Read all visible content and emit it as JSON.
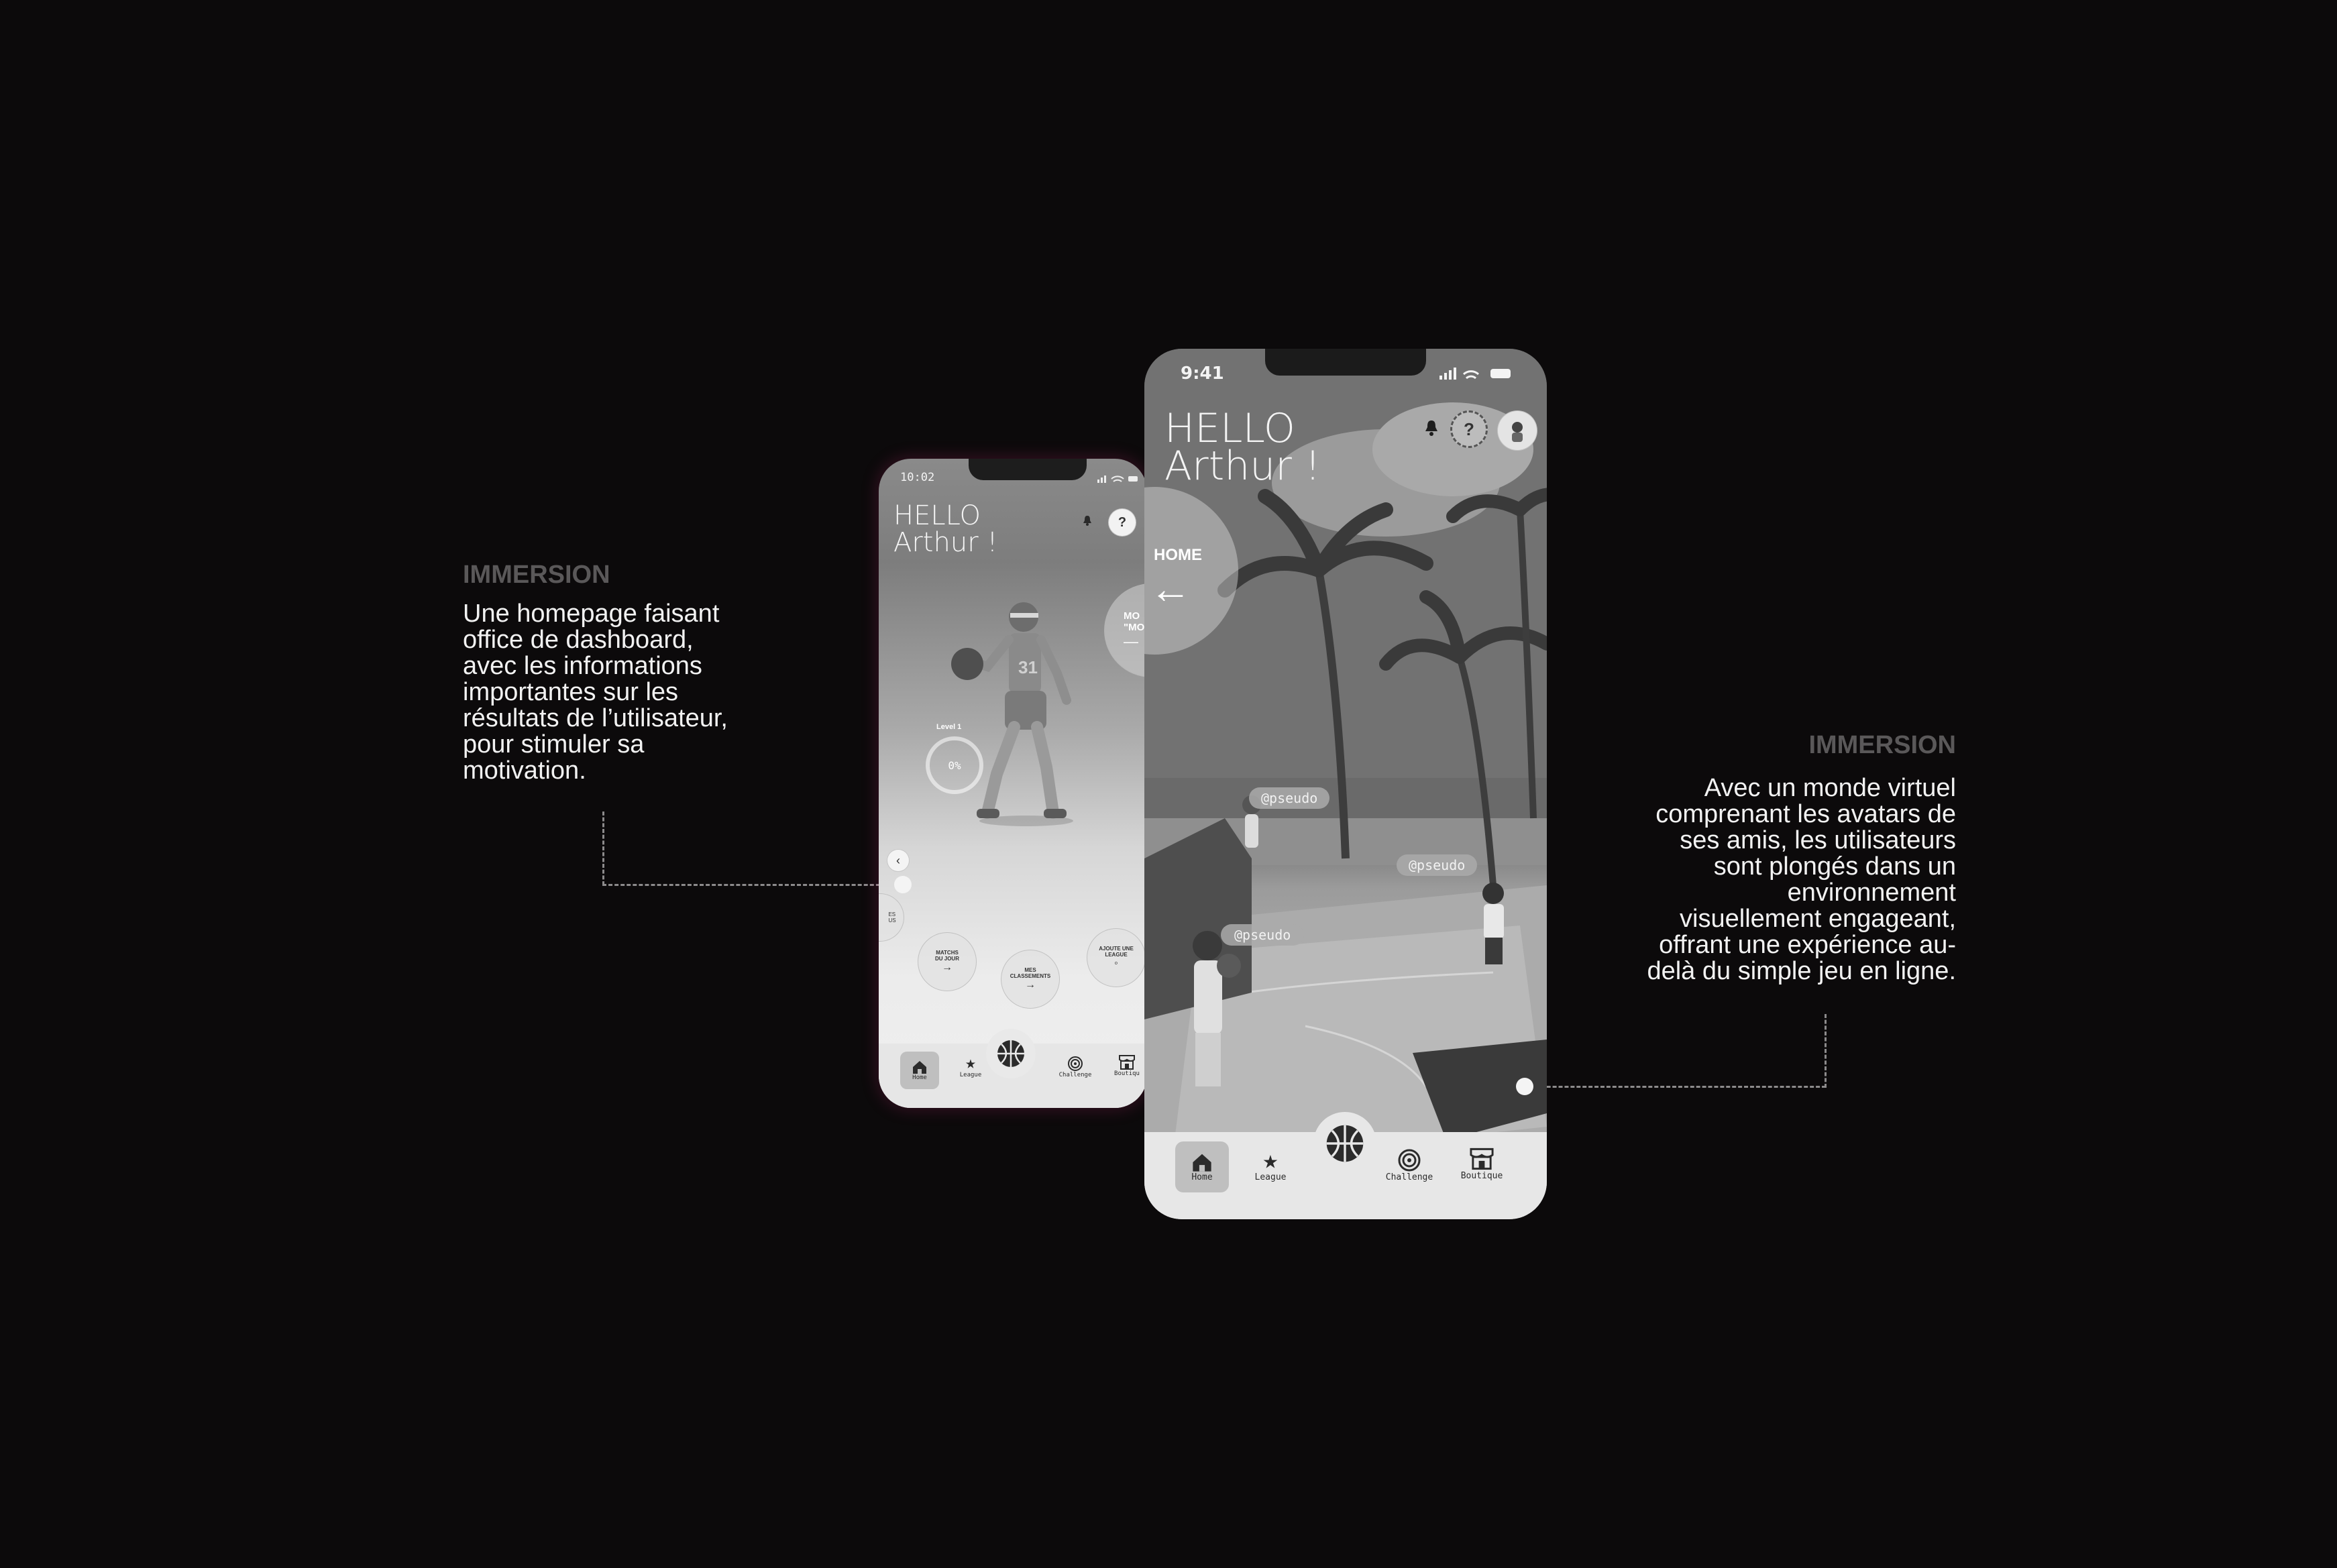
{
  "left_annotation": {
    "title": "IMMERSION",
    "lines": [
      "Une homepage faisant",
      "office de dashboard,",
      "avec les informations",
      "importantes sur les",
      "résultats de l’utilisateur,",
      "pour stimuler sa",
      "motivation."
    ]
  },
  "right_annotation": {
    "title": "IMMERSION",
    "lines": [
      "Avec un monde virtuel",
      "comprenant les avatars de",
      "ses amis, les utilisateurs",
      "sont plongés dans un",
      "environnement",
      "visuellement engageant,",
      "offrant une expérience au-",
      "delà du simple jeu en ligne."
    ]
  },
  "phone_dashboard": {
    "time": "10:02",
    "hello": "HELLO",
    "name": "Arthur !",
    "help": "?",
    "level_label": "Level 1",
    "level_percent": "0%",
    "side_bubble": "MO\n\"MO",
    "shortcuts": [
      {
        "label": "MATCHS DU JOUR",
        "arrow": "→"
      },
      {
        "label": "MES CLASSEMENTS",
        "arrow": "→"
      },
      {
        "label": "AJOUTE UNE LEAGUE",
        "arrow": "◦"
      }
    ],
    "left_partial_label": "ES\nUS",
    "jersey_number": "31",
    "nav": [
      "Home",
      "League",
      "Challenge",
      "Boutiqu"
    ]
  },
  "phone_world": {
    "time": "9:41",
    "hello": "HELLO",
    "name": "Arthur !",
    "help": "?",
    "home_label": "HOME",
    "back_arrow": "←",
    "pseudos": [
      "@pseudo",
      "@pseudo",
      "@pseudo"
    ],
    "nav": [
      "Home",
      "League",
      "Challenge",
      "Boutique"
    ]
  }
}
